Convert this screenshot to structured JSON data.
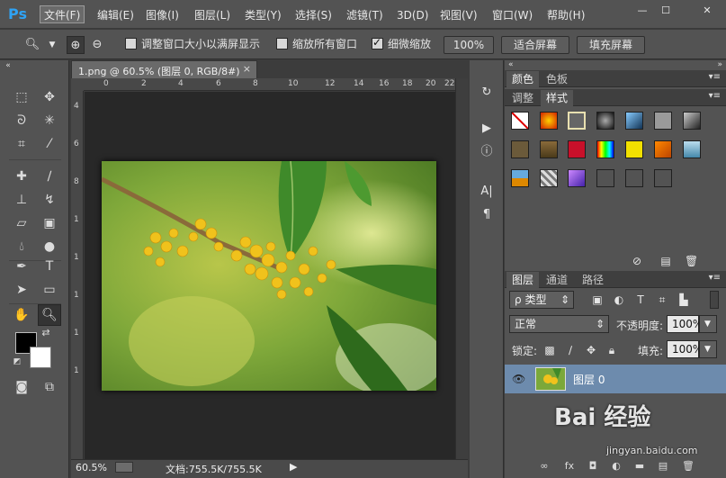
{
  "app": {
    "logo": "Ps"
  },
  "menu": [
    "文件(F)",
    "编辑(E)",
    "图像(I)",
    "图层(L)",
    "类型(Y)",
    "选择(S)",
    "滤镜(T)",
    "3D(D)",
    "视图(V)",
    "窗口(W)",
    "帮助(H)"
  ],
  "window": {
    "minimize": "—",
    "maximize": "☐",
    "close": "✕"
  },
  "options": {
    "resize_windows_label": "调整窗口大小以满屏显示",
    "zoom_all_label": "缩放所有窗口",
    "scrubby_label": "细微缩放",
    "zoom_100": "100%",
    "fit_screen": "适合屏幕",
    "fill_screen": "填充屏幕"
  },
  "document": {
    "tab_title": "1.png @ 60.5% (图层 0, RGB/8#)",
    "close": "×",
    "ruler_top": [
      "0",
      "2",
      "4",
      "6",
      "8",
      "10",
      "12",
      "14",
      "16",
      "18",
      "20",
      "22"
    ],
    "ruler_left": [
      "4",
      "6",
      "8",
      "1",
      "1",
      "1",
      "1",
      "1"
    ]
  },
  "status": {
    "zoom": "60.5%",
    "doc": "文档:755.5K/755.5K",
    "arrow": "▶"
  },
  "panels": {
    "top_tabs": [
      "颜色",
      "色板"
    ],
    "mid_tabs": [
      "调整",
      "样式"
    ],
    "layer_tabs": [
      "图层",
      "通道",
      "路径"
    ],
    "filter_kind": "类型",
    "blend_mode": "正常",
    "opacity_label": "不透明度:",
    "opacity_value": "100%",
    "lock_label": "锁定:",
    "fill_label": "填充:",
    "fill_value": "100%",
    "layer_name": "图层 0"
  },
  "watermark": {
    "text": "Bai 经验",
    "sub": "jingyan.baidu.com"
  },
  "colors": {
    "ui_bg": "#535353",
    "canvas": "#282828",
    "selected_layer": "#6d8bad",
    "accent_logo": "#2fa3f5"
  }
}
